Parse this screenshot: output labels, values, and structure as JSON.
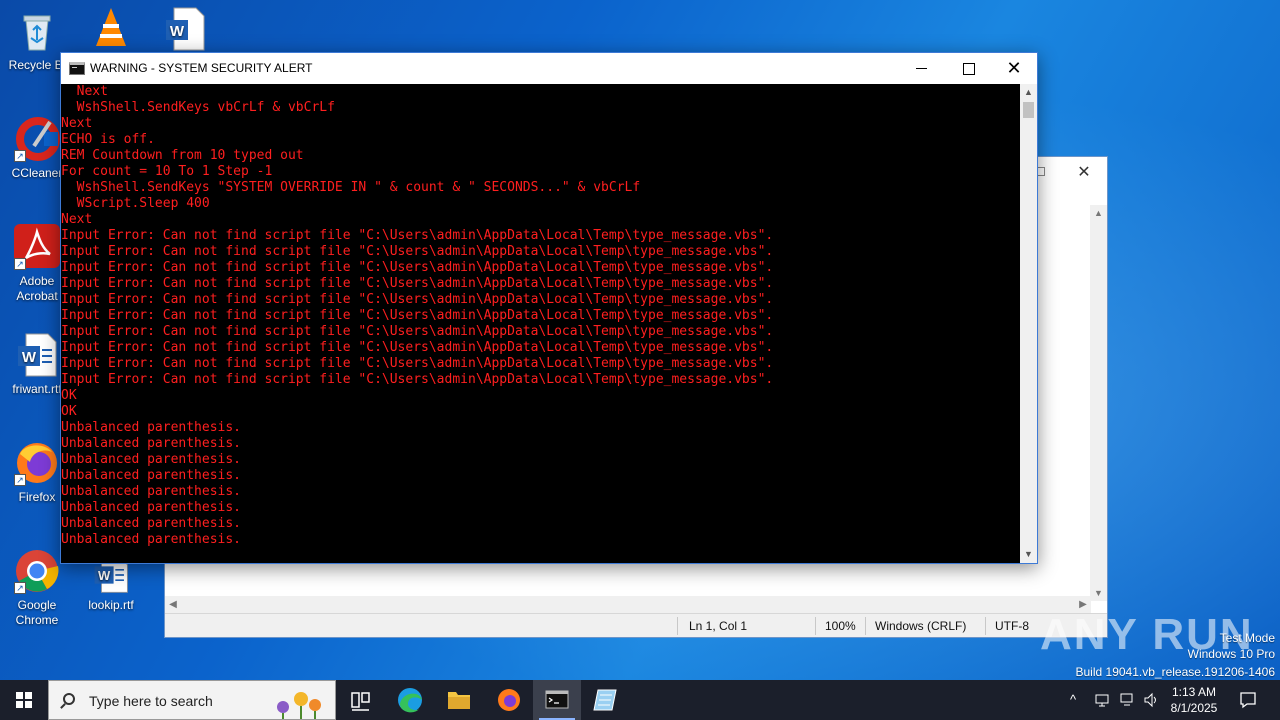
{
  "desktop": {
    "icons": [
      {
        "label": "Recycle Bi"
      },
      {
        "label": "CCleaner"
      },
      {
        "label": "Adobe Acrobat"
      },
      {
        "label": "friwant.rtf"
      },
      {
        "label": "Firefox"
      },
      {
        "label": "Google Chrome"
      },
      {
        "label": "lookip.rtf"
      }
    ]
  },
  "console": {
    "title": "WARNING - SYSTEM SECURITY ALERT",
    "lines": [
      "  Next",
      "  WshShell.SendKeys vbCrLf & vbCrLf",
      "Next",
      "ECHO is off.",
      "REM Countdown from 10 typed out",
      "For count = 10 To 1 Step -1",
      "  WshShell.SendKeys \"SYSTEM OVERRIDE IN \" & count & \" SECONDS...\" & vbCrLf",
      "  WScript.Sleep 400",
      "Next",
      "Input Error: Can not find script file \"C:\\Users\\admin\\AppData\\Local\\Temp\\type_message.vbs\".",
      "Input Error: Can not find script file \"C:\\Users\\admin\\AppData\\Local\\Temp\\type_message.vbs\".",
      "Input Error: Can not find script file \"C:\\Users\\admin\\AppData\\Local\\Temp\\type_message.vbs\".",
      "Input Error: Can not find script file \"C:\\Users\\admin\\AppData\\Local\\Temp\\type_message.vbs\".",
      "Input Error: Can not find script file \"C:\\Users\\admin\\AppData\\Local\\Temp\\type_message.vbs\".",
      "Input Error: Can not find script file \"C:\\Users\\admin\\AppData\\Local\\Temp\\type_message.vbs\".",
      "Input Error: Can not find script file \"C:\\Users\\admin\\AppData\\Local\\Temp\\type_message.vbs\".",
      "Input Error: Can not find script file \"C:\\Users\\admin\\AppData\\Local\\Temp\\type_message.vbs\".",
      "Input Error: Can not find script file \"C:\\Users\\admin\\AppData\\Local\\Temp\\type_message.vbs\".",
      "Input Error: Can not find script file \"C:\\Users\\admin\\AppData\\Local\\Temp\\type_message.vbs\".",
      "OK",
      "OK",
      "Unbalanced parenthesis.",
      "Unbalanced parenthesis.",
      "Unbalanced parenthesis.",
      "Unbalanced parenthesis.",
      "Unbalanced parenthesis.",
      "Unbalanced parenthesis.",
      "Unbalanced parenthesis.",
      "Unbalanced parenthesis."
    ],
    "text_color": "#ff1f1f"
  },
  "notepad": {
    "status": {
      "position": "Ln 1, Col 1",
      "zoom": "100%",
      "line_endings": "Windows (CRLF)",
      "encoding": "UTF-8"
    }
  },
  "watermark": {
    "brand": "ANY RUN",
    "mode": "Test Mode",
    "os": "Windows 10 Pro",
    "build": "Build 19041.vb_release.191206-1406"
  },
  "taskbar": {
    "search_placeholder": "Type here to search",
    "time": "1:13 AM",
    "date": "8/1/2025"
  }
}
